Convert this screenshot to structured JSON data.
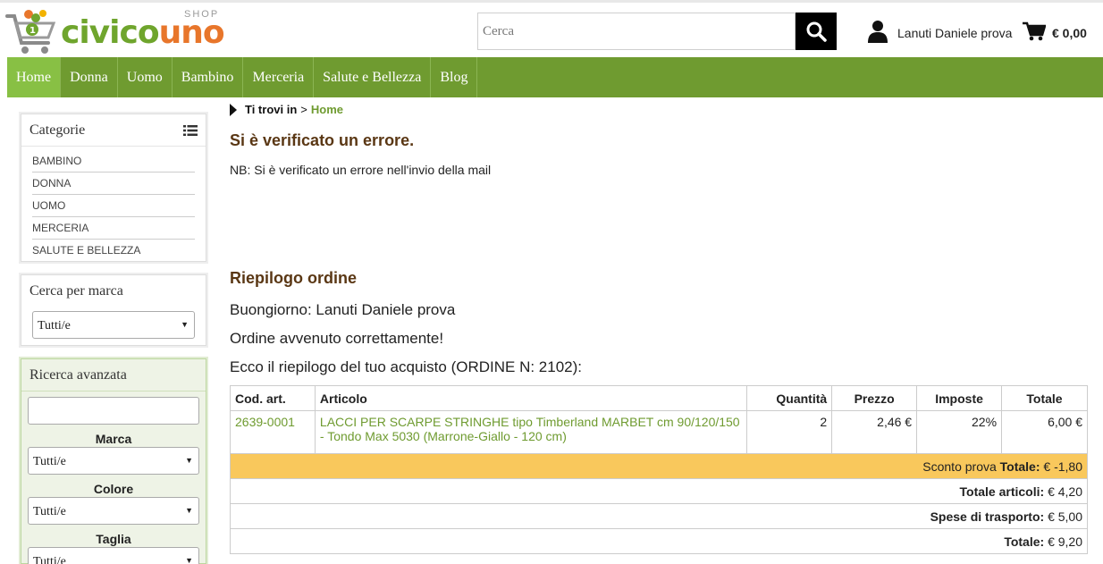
{
  "header": {
    "logo": {
      "main_left": "civico",
      "main_right": "uno",
      "shop": "SHOP"
    },
    "search": {
      "placeholder": "Cerca"
    },
    "user_name": "Lanuti Daniele prova",
    "cart_total": "€ 0,00"
  },
  "nav": {
    "items": [
      {
        "label": "Home",
        "active": true
      },
      {
        "label": "Donna"
      },
      {
        "label": "Uomo"
      },
      {
        "label": "Bambino"
      },
      {
        "label": "Merceria"
      },
      {
        "label": "Salute e Bellezza"
      },
      {
        "label": "Blog"
      }
    ]
  },
  "sidebar": {
    "categories": {
      "title": "Categorie",
      "items": [
        "BAMBINO",
        "DONNA",
        "UOMO",
        "MERCERIA",
        "SALUTE E BELLEZZA"
      ]
    },
    "brand": {
      "title": "Cerca per marca",
      "selected": "Tutti/e"
    },
    "advanced": {
      "title": "Ricerca avanzata",
      "fields": [
        {
          "label": "Marca",
          "selected": "Tutti/e"
        },
        {
          "label": "Colore",
          "selected": "Tutti/e"
        },
        {
          "label": "Taglia",
          "selected": "Tutti/e"
        }
      ]
    }
  },
  "main": {
    "breadcrumb": {
      "prefix": "Ti trovi in",
      "separator": ">",
      "home": "Home"
    },
    "error_title": "Si è verificato un errore.",
    "error_message": "NB: Si è verificato un errore nell'invio della mail",
    "summary_title": "Riepilogo ordine",
    "greeting": "Buongiorno: Lanuti Daniele prova",
    "confirmation": "Ordine avvenuto correttamente!",
    "recap": "Ecco il riepilogo del tuo acquisto (ORDINE N: 2102):",
    "table": {
      "headers": [
        "Cod. art.",
        "Articolo",
        "Quantità",
        "Prezzo",
        "Imposte",
        "Totale"
      ],
      "row": {
        "code": "2639-0001",
        "article": "LACCI PER SCARPE STRINGHE tipo Timberland MARBET cm 90/120/150 - Tondo Max 5030 (Marrone-Giallo - 120 cm)",
        "quantity": "2",
        "price": "2,46 €",
        "tax": "22%",
        "total": "6,00 €"
      },
      "discount": {
        "name": "Sconto prova",
        "label": "Totale:",
        "value": "€ -1,80"
      },
      "items_total": {
        "label": "Totale articoli:",
        "value": "€ 4,20"
      },
      "shipping": {
        "label": "Spese di trasporto:",
        "value": "€ 5,00"
      },
      "grand_total": {
        "label": "Totale:",
        "value": "€ 9,20"
      }
    }
  },
  "colors": {
    "brand_green": "#6f9b30",
    "active_green": "#88c044",
    "title_brown": "#5a3714",
    "discount_bg": "#f9c85c"
  }
}
